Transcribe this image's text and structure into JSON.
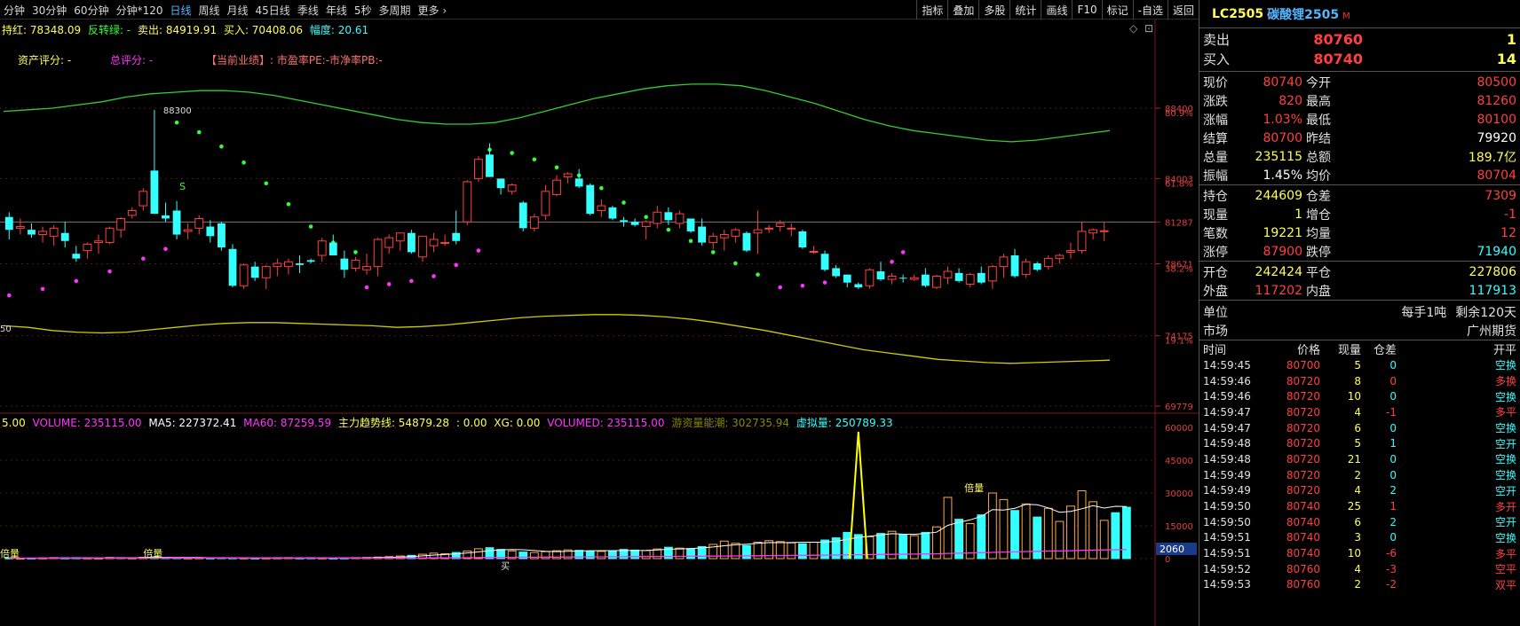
{
  "toolbar": {
    "periods": [
      "分钟",
      "30分钟",
      "60分钟",
      "分钟*120",
      "日线",
      "周线",
      "月线",
      "45日线",
      "季线",
      "年线",
      "5秒",
      "多周期",
      "更多"
    ],
    "active_period": "日线",
    "more_arrow": "›",
    "tools": [
      "指标",
      "叠加",
      "多股",
      "统计",
      "画线",
      "F10",
      "标记",
      "-自选",
      "返回"
    ]
  },
  "main_info": {
    "l1": "持红: 78348.09",
    "l2": "反转绿: -",
    "l3": "卖出: 84919.91",
    "l4": "买入: 70408.06",
    "l5": "幅度: 20.61",
    "asset_score": "资产评分: -",
    "total_score": "总评分: -",
    "perf": "【当前业绩】: 市盈率PE:-市净率PB:-",
    "high_label": "88300",
    "low_label": "50",
    "s_marker": "S",
    "y_ticks": [
      "88400",
      "84003",
      "81287",
      "78671",
      "74175",
      "69779"
    ],
    "y_pct": [
      "80.9%",
      "61.8%",
      "38.2%",
      "19.1%"
    ],
    "corner_icons": [
      "◇",
      "⊡"
    ]
  },
  "vol_info": {
    "l0": "5.00",
    "l1": "VOLUME: 235115.00",
    "l2": "MA5: 227372.41",
    "l3": "MA60: 87259.59",
    "l4": "主力趋势线: 54879.28",
    "l5": ": 0.00",
    "l6": "XG: 0.00",
    "l7": "VOLUMED: 235115.00",
    "l8": "游资量能潮: 302735.94",
    "l9": "虚拟量: 250789.33",
    "y_ticks": [
      "60000",
      "45000",
      "30000",
      "15000",
      "0"
    ],
    "cursor_val": "2060",
    "bei_liang": "倍量",
    "buy_mark": "买"
  },
  "colors": {
    "up": "#ff4040",
    "down": "#33ffff",
    "green_line": "#33cc33",
    "yellow_line": "#cccc00",
    "magenta": "#ff33ff",
    "green_dot": "#33ff33"
  },
  "chart_data": {
    "type": "candlestick",
    "price_range": [
      69779,
      88400
    ],
    "volume_range": [
      0,
      60000
    ],
    "candles": [
      [
        81600,
        81900,
        80200,
        80800
      ],
      [
        80900,
        81500,
        80500,
        81000
      ],
      [
        80800,
        81200,
        80300,
        80500
      ],
      [
        80500,
        81000,
        80000,
        80700
      ],
      [
        80400,
        81100,
        79800,
        80900
      ],
      [
        80600,
        81300,
        79700,
        80100
      ],
      [
        79300,
        79800,
        78800,
        79000
      ],
      [
        79500,
        80000,
        79000,
        79900
      ],
      [
        80000,
        80500,
        79300,
        80100
      ],
      [
        80000,
        81000,
        79900,
        80900
      ],
      [
        80800,
        81600,
        80300,
        81500
      ],
      [
        81700,
        82200,
        81500,
        82000
      ],
      [
        82300,
        83400,
        82000,
        83200
      ],
      [
        84500,
        88300,
        81800,
        81800
      ],
      [
        81700,
        82500,
        81300,
        81500
      ],
      [
        82000,
        82600,
        80200,
        80500
      ],
      [
        80700,
        81200,
        80200,
        80800
      ],
      [
        80900,
        81700,
        80500,
        81500
      ],
      [
        81000,
        81400,
        80000,
        80400
      ],
      [
        81200,
        81300,
        79500,
        79700
      ],
      [
        79600,
        79900,
        77200,
        77300
      ],
      [
        77300,
        78700,
        77100,
        78600
      ],
      [
        78500,
        78800,
        77600,
        77800
      ],
      [
        77800,
        78600,
        77100,
        78500
      ],
      [
        78500,
        79000,
        77900,
        78700
      ],
      [
        78500,
        79000,
        78000,
        78800
      ],
      [
        78700,
        79200,
        78100,
        78600
      ],
      [
        78900,
        79000,
        78700,
        78800
      ],
      [
        79200,
        80300,
        78800,
        80100
      ],
      [
        80000,
        80500,
        79200,
        79200
      ],
      [
        79000,
        79500,
        77800,
        78300
      ],
      [
        78400,
        79100,
        78200,
        78900
      ],
      [
        78300,
        79300,
        78000,
        78500
      ],
      [
        78500,
        80300,
        77900,
        80200
      ],
      [
        79700,
        80500,
        79300,
        80300
      ],
      [
        80100,
        80600,
        79500,
        80600
      ],
      [
        80600,
        80800,
        79300,
        79400
      ],
      [
        79100,
        80400,
        78800,
        80400
      ],
      [
        79800,
        80600,
        79400,
        80200
      ],
      [
        80000,
        80500,
        79800,
        80000
      ],
      [
        80600,
        82000,
        79900,
        80100
      ],
      [
        81300,
        83900,
        81100,
        83800
      ],
      [
        84000,
        85400,
        83800,
        85200
      ],
      [
        85500,
        86200,
        84100,
        84100
      ],
      [
        84000,
        84000,
        83000,
        83400
      ],
      [
        83200,
        83700,
        83000,
        83600
      ],
      [
        82500,
        82600,
        80700,
        80900
      ],
      [
        80900,
        81800,
        80700,
        81600
      ],
      [
        81700,
        83600,
        81400,
        83200
      ],
      [
        83000,
        84200,
        82900,
        83900
      ],
      [
        84100,
        84400,
        83700,
        84300
      ],
      [
        84000,
        84600,
        83400,
        83500
      ],
      [
        83600,
        83700,
        81700,
        81800
      ],
      [
        82000,
        82700,
        81600,
        82300
      ],
      [
        82200,
        82300,
        81400,
        81500
      ],
      [
        81400,
        81600,
        81000,
        81300
      ],
      [
        81300,
        81500,
        81000,
        81100
      ],
      [
        81000,
        81400,
        80200,
        81300
      ],
      [
        81200,
        82300,
        80900,
        81900
      ],
      [
        81900,
        82200,
        81100,
        81400
      ],
      [
        81200,
        82000,
        80900,
        81800
      ],
      [
        81500,
        81500,
        80600,
        80700
      ],
      [
        81000,
        81500,
        79800,
        80000
      ],
      [
        80000,
        80600,
        79600,
        80400
      ],
      [
        80300,
        80800,
        79500,
        80500
      ],
      [
        80400,
        80900,
        80000,
        80800
      ],
      [
        80600,
        80700,
        79400,
        79500
      ],
      [
        80600,
        82000,
        79300,
        80800
      ],
      [
        80900,
        81100,
        80600,
        80900
      ],
      [
        81000,
        81400,
        80700,
        81200
      ],
      [
        80900,
        81200,
        80400,
        80900
      ],
      [
        80700,
        80800,
        79600,
        79700
      ],
      [
        79400,
        79800,
        79300,
        79450
      ],
      [
        79300,
        79500,
        78200,
        78300
      ],
      [
        78400,
        78600,
        77800,
        77900
      ],
      [
        78000,
        78000,
        77200,
        77500
      ],
      [
        77400,
        77500,
        77100,
        77200
      ],
      [
        77300,
        78400,
        77100,
        78300
      ],
      [
        78200,
        78800,
        77600,
        77700
      ],
      [
        77700,
        78100,
        77400,
        77900
      ],
      [
        77800,
        78000,
        77500,
        77750
      ],
      [
        77700,
        78000,
        77600,
        77800
      ],
      [
        78000,
        78400,
        77200,
        77300
      ],
      [
        77200,
        78000,
        77100,
        77900
      ],
      [
        77800,
        78500,
        77400,
        78200
      ],
      [
        78100,
        78400,
        77500,
        77600
      ],
      [
        77400,
        78100,
        77200,
        78000
      ],
      [
        78100,
        78500,
        77400,
        77500
      ],
      [
        77600,
        78600,
        77100,
        78500
      ],
      [
        78500,
        79300,
        77800,
        79100
      ],
      [
        79200,
        79600,
        77800,
        77900
      ],
      [
        78000,
        79000,
        77800,
        78800
      ],
      [
        78700,
        78800,
        78200,
        78300
      ],
      [
        78500,
        79200,
        78300,
        79000
      ],
      [
        79000,
        79300,
        78700,
        79200
      ],
      [
        79400,
        80000,
        79000,
        79500
      ],
      [
        79500,
        81300,
        79300,
        80700
      ],
      [
        80600,
        80900,
        80200,
        80800
      ],
      [
        80700,
        81260,
        80100,
        80740
      ]
    ],
    "volumes": [
      300,
      200,
      250,
      300,
      400,
      300,
      350,
      300,
      250,
      500,
      400,
      300,
      600,
      800,
      500,
      400,
      300,
      350,
      300,
      400,
      350,
      300,
      250,
      300,
      350,
      400,
      300,
      350,
      300,
      250,
      300,
      400,
      500,
      700,
      900,
      1200,
      1500,
      2000,
      2500,
      2200,
      2800,
      3500,
      4500,
      5000,
      4200,
      3500,
      3000,
      2800,
      3200,
      3600,
      4000,
      3800,
      3500,
      3300,
      3600,
      4200,
      3900,
      3700,
      4400,
      5200,
      4800,
      4600,
      5500,
      6500,
      8000,
      7000,
      6000,
      7500,
      8200,
      7800,
      7200,
      6800,
      7500,
      8500,
      9500,
      12000,
      11000,
      10000,
      11500,
      12500,
      11000,
      10500,
      12000,
      14500,
      28000,
      18000,
      16000,
      20000,
      30000,
      27000,
      22000,
      25000,
      19000,
      23000,
      17000,
      24000,
      31000,
      26000,
      17500,
      21000,
      23500
    ],
    "upper_band": [
      88200,
      88300,
      88400,
      88600,
      88800,
      89100,
      89300,
      89400,
      89500,
      89500,
      89400,
      89200,
      88900,
      88600,
      88300,
      88000,
      87700,
      87500,
      87400,
      87400,
      87500,
      87800,
      88200,
      88600,
      89000,
      89300,
      89600,
      89800,
      89900,
      89900,
      89800,
      89500,
      89100,
      88700,
      88200,
      87700,
      87300,
      87000,
      86800,
      86600,
      86400,
      86300,
      86400,
      86600,
      86800,
      87000
    ],
    "lower_band": [
      74800,
      74700,
      74500,
      74400,
      74350,
      74400,
      74550,
      74700,
      74850,
      74950,
      75000,
      75000,
      74950,
      74900,
      74850,
      74800,
      74700,
      74750,
      74850,
      75000,
      75150,
      75300,
      75400,
      75450,
      75500,
      75500,
      75450,
      75350,
      75200,
      75000,
      74750,
      74500,
      74200,
      73900,
      73600,
      73300,
      73100,
      72900,
      72700,
      72600,
      72500,
      72450,
      72500,
      72550,
      72600,
      72650
    ],
    "sar": [
      [
        0,
        76700,
        "m"
      ],
      [
        3,
        77100,
        "m"
      ],
      [
        6,
        77600,
        "m"
      ],
      [
        9,
        78200,
        "m"
      ],
      [
        12,
        79000,
        "m"
      ],
      [
        14,
        79600,
        "m"
      ],
      [
        15,
        87500,
        "g"
      ],
      [
        17,
        86900,
        "g"
      ],
      [
        19,
        86000,
        "g"
      ],
      [
        21,
        85000,
        "g"
      ],
      [
        23,
        83700,
        "g"
      ],
      [
        25,
        82400,
        "g"
      ],
      [
        27,
        81000,
        "g"
      ],
      [
        29,
        80000,
        "g"
      ],
      [
        31,
        79400,
        "g"
      ],
      [
        32,
        77200,
        "m"
      ],
      [
        34,
        77400,
        "m"
      ],
      [
        36,
        77600,
        "m"
      ],
      [
        38,
        77900,
        "m"
      ],
      [
        40,
        78600,
        "m"
      ],
      [
        42,
        79500,
        "m"
      ],
      [
        43,
        85800,
        "g"
      ],
      [
        45,
        85600,
        "g"
      ],
      [
        47,
        85200,
        "g"
      ],
      [
        49,
        84700,
        "g"
      ],
      [
        51,
        84200,
        "g"
      ],
      [
        53,
        83400,
        "g"
      ],
      [
        55,
        82500,
        "g"
      ],
      [
        57,
        81600,
        "g"
      ],
      [
        59,
        80800,
        "g"
      ],
      [
        61,
        80100,
        "g"
      ],
      [
        63,
        79400,
        "g"
      ],
      [
        65,
        78700,
        "g"
      ],
      [
        67,
        78000,
        "g"
      ],
      [
        69,
        77200,
        "m"
      ],
      [
        71,
        77300,
        "m"
      ],
      [
        73,
        77500,
        "m"
      ],
      [
        75,
        77800,
        "m"
      ],
      [
        77,
        78200,
        "m"
      ],
      [
        79,
        78800,
        "m"
      ],
      [
        80,
        79400,
        "m"
      ]
    ]
  },
  "panel": {
    "code": "LC2505",
    "name": "碳酸锂2505",
    "m_badge": "M",
    "sell_label": "卖出",
    "sell_price": "80760",
    "sell_vol": "1",
    "buy_label": "买入",
    "buy_price": "80740",
    "buy_vol": "14",
    "quotes": [
      {
        "l1": "现价",
        "v1": "80740",
        "c1": "red",
        "l2": "今开",
        "v2": "80500",
        "c2": "red"
      },
      {
        "l1": "涨跌",
        "v1": "820",
        "c1": "red",
        "l2": "最高",
        "v2": "81260",
        "c2": "red"
      },
      {
        "l1": "涨幅",
        "v1": "1.03%",
        "c1": "red",
        "l2": "最低",
        "v2": "80100",
        "c2": "red"
      },
      {
        "l1": "结算",
        "v1": "80700",
        "c1": "red",
        "l2": "昨结",
        "v2": "79920",
        "c2": "wht"
      },
      {
        "l1": "总量",
        "v1": "235115",
        "c1": "yel",
        "l2": "总额",
        "v2": "189.7亿",
        "c2": "yel"
      },
      {
        "l1": "振幅",
        "v1": "1.45%",
        "c1": "wht",
        "l2": "均价",
        "v2": "80704",
        "c2": "red"
      }
    ],
    "quotes2": [
      {
        "l1": "持仓",
        "v1": "244609",
        "c1": "yel",
        "l2": "仓差",
        "v2": "7309",
        "c2": "red"
      },
      {
        "l1": "现量",
        "v1": "1",
        "c1": "yel",
        "l2": "增仓",
        "v2": "-1",
        "c2": "red"
      },
      {
        "l1": "笔数",
        "v1": "19221",
        "c1": "yel",
        "l2": "均量",
        "v2": "12",
        "c2": "red"
      },
      {
        "l1": "涨停",
        "v1": "87900",
        "c1": "red",
        "l2": "跌停",
        "v2": "71940",
        "c2": "cya"
      }
    ],
    "quotes3": [
      {
        "l1": "开仓",
        "v1": "242424",
        "c1": "yel",
        "l2": "平仓",
        "v2": "227806",
        "c2": "yel"
      },
      {
        "l1": "外盘",
        "v1": "117202",
        "c1": "red",
        "l2": "内盘",
        "v2": "117913",
        "c2": "cya"
      }
    ],
    "unit_label": "单位",
    "unit_val1": "每手1吨",
    "unit_val2": "剩余120天",
    "market_label": "市场",
    "market_val": "广州期货",
    "tick_headers": [
      "时间",
      "价格",
      "现量",
      "仓差",
      "开平"
    ],
    "ticks": [
      {
        "t": "14:59:45",
        "p": "80700",
        "v": "5",
        "d": "0",
        "dc": "cya",
        "k": "空换",
        "kc": "cya"
      },
      {
        "t": "14:59:46",
        "p": "80720",
        "v": "8",
        "d": "0",
        "dc": "red",
        "k": "多换",
        "kc": "red"
      },
      {
        "t": "14:59:46",
        "p": "80720",
        "v": "10",
        "d": "0",
        "dc": "cya",
        "k": "空换",
        "kc": "cya"
      },
      {
        "t": "14:59:47",
        "p": "80720",
        "v": "4",
        "d": "-1",
        "dc": "red",
        "k": "多平",
        "kc": "red"
      },
      {
        "t": "14:59:47",
        "p": "80720",
        "v": "6",
        "d": "0",
        "dc": "cya",
        "k": "空换",
        "kc": "cya"
      },
      {
        "t": "14:59:48",
        "p": "80720",
        "v": "5",
        "d": "1",
        "dc": "cya",
        "k": "空开",
        "kc": "cya"
      },
      {
        "t": "14:59:48",
        "p": "80720",
        "v": "21",
        "d": "0",
        "dc": "cya",
        "k": "空换",
        "kc": "cya"
      },
      {
        "t": "14:59:49",
        "p": "80720",
        "v": "2",
        "d": "0",
        "dc": "cya",
        "k": "空换",
        "kc": "cya"
      },
      {
        "t": "14:59:49",
        "p": "80720",
        "v": "4",
        "d": "2",
        "dc": "cya",
        "k": "空开",
        "kc": "cya"
      },
      {
        "t": "14:59:50",
        "p": "80740",
        "v": "25",
        "d": "1",
        "dc": "red",
        "k": "多开",
        "kc": "red"
      },
      {
        "t": "14:59:50",
        "p": "80740",
        "v": "6",
        "d": "2",
        "dc": "cya",
        "k": "空开",
        "kc": "cya"
      },
      {
        "t": "14:59:51",
        "p": "80740",
        "v": "3",
        "d": "0",
        "dc": "cya",
        "k": "空换",
        "kc": "cya"
      },
      {
        "t": "14:59:51",
        "p": "80740",
        "v": "10",
        "d": "-6",
        "dc": "red",
        "k": "多平",
        "kc": "red"
      },
      {
        "t": "14:59:52",
        "p": "80760",
        "v": "4",
        "d": "-3",
        "dc": "red",
        "k": "空平",
        "kc": "red"
      },
      {
        "t": "14:59:53",
        "p": "80760",
        "v": "2",
        "d": "-2",
        "dc": "red",
        "k": "双平",
        "kc": "red"
      }
    ]
  }
}
